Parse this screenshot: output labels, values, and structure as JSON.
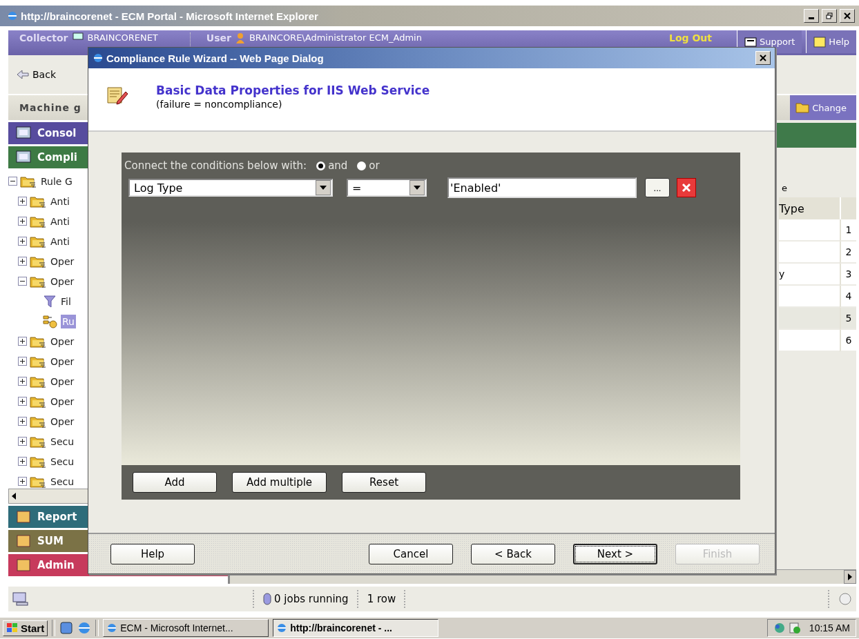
{
  "browser": {
    "title": "http://braincorenet - ECM Portal - Microsoft Internet Explorer"
  },
  "header": {
    "collector_label": "Collector",
    "collector_value": "BRAINCORENET",
    "user_label": "User",
    "user_value": "BRAINCORE\\Administrator  ECM_Admin",
    "logout": "Log Out",
    "support": "Support",
    "help": "Help"
  },
  "toolbar": {
    "back": "Back"
  },
  "machine_bar": {
    "label": "Machine g",
    "change": "Change"
  },
  "nav_top": [
    {
      "label": "Consol",
      "color": "#574c9e"
    },
    {
      "label": "Compli",
      "color": "#3d7a44"
    }
  ],
  "tree": {
    "label": "Rule G",
    "kind": "folder",
    "expanded": true,
    "selected": false,
    "children": [
      {
        "label": "Anti",
        "kind": "folder",
        "expanded": false,
        "selected": false
      },
      {
        "label": "Anti",
        "kind": "folder",
        "expanded": false,
        "selected": false
      },
      {
        "label": "Anti",
        "kind": "folder",
        "expanded": false,
        "selected": false
      },
      {
        "label": "Oper",
        "kind": "folder",
        "expanded": false,
        "selected": false
      },
      {
        "label": "Oper",
        "kind": "folder",
        "expanded": true,
        "selected": false,
        "children": [
          {
            "label": "Fil",
            "kind": "filter",
            "selected": false
          },
          {
            "label": "Ru",
            "kind": "rule",
            "selected": true
          }
        ]
      },
      {
        "label": "Oper",
        "kind": "folder",
        "expanded": false,
        "selected": false
      },
      {
        "label": "Oper",
        "kind": "folder",
        "expanded": false,
        "selected": false
      },
      {
        "label": "Oper",
        "kind": "folder",
        "expanded": false,
        "selected": false
      },
      {
        "label": "Oper",
        "kind": "folder",
        "expanded": false,
        "selected": false
      },
      {
        "label": "Oper",
        "kind": "folder",
        "expanded": false,
        "selected": false
      },
      {
        "label": "Secu",
        "kind": "folder",
        "expanded": false,
        "selected": false
      },
      {
        "label": "Secu",
        "kind": "folder",
        "expanded": false,
        "selected": false
      },
      {
        "label": "Secu",
        "kind": "folder",
        "expanded": false,
        "selected": false
      }
    ]
  },
  "nav_bottom": [
    {
      "label": "Report",
      "color": "#2e6c7a"
    },
    {
      "label": "SUM",
      "color": "#7b7246"
    },
    {
      "label": "Admin",
      "color": "#c73a5c"
    }
  ],
  "table": {
    "caption": "e",
    "column_1": "Type",
    "rows": [
      {
        "number": "1",
        "selected": false
      },
      {
        "number": "2",
        "selected": false
      },
      {
        "type": "y",
        "number": "3",
        "selected": false
      },
      {
        "number": "4",
        "selected": false
      },
      {
        "number": "5",
        "selected": true
      },
      {
        "number": "6",
        "selected": false
      }
    ]
  },
  "status_bar": {
    "jobs": "0 jobs running",
    "rows": "1 row"
  },
  "taskbar": {
    "start": "Start",
    "tasks": [
      {
        "label": "ECM - Microsoft Internet...",
        "selected": false
      },
      {
        "label": "http://braincorenet - ...",
        "selected": true
      }
    ],
    "clock": "10:15 AM"
  },
  "dialog": {
    "title": "Compliance Rule Wizard -- Web Page Dialog",
    "heading": "Basic Data Properties for IIS Web Service",
    "subheading": "(failure = noncompliance)",
    "connect_label": "Connect the conditions below with:",
    "connectors": [
      {
        "label": "and",
        "selected": true
      },
      {
        "label": "or",
        "selected": false
      }
    ],
    "conditions": [
      {
        "field": "Log Type",
        "operator": "=",
        "value": "'Enabled'"
      }
    ],
    "browse": "...",
    "actions": [
      "Add",
      "Add multiple",
      "Reset"
    ],
    "footer": [
      {
        "label": "Help",
        "disabled": false,
        "focused": false
      },
      {
        "label": "Cancel",
        "disabled": false,
        "focused": false
      },
      {
        "label": "< Back",
        "disabled": false,
        "focused": false
      },
      {
        "label": "Next >",
        "disabled": false,
        "focused": true
      },
      {
        "label": "Finish",
        "disabled": true,
        "focused": false
      }
    ]
  }
}
